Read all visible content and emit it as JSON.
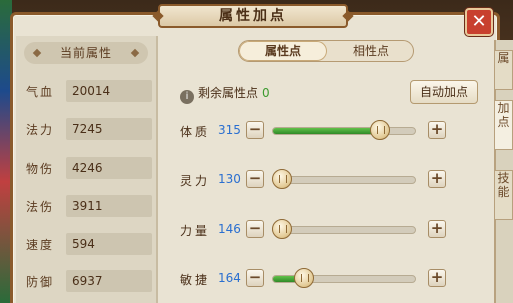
{
  "window": {
    "title": "属性加点",
    "close_label": "✕"
  },
  "left_panel": {
    "header": "当前属性",
    "stats": [
      {
        "label": "气血",
        "value": "20014"
      },
      {
        "label": "法力",
        "value": "7245"
      },
      {
        "label": "物伤",
        "value": "4246"
      },
      {
        "label": "法伤",
        "value": "3911"
      },
      {
        "label": "速度",
        "value": "594"
      },
      {
        "label": "防御",
        "value": "6937"
      }
    ]
  },
  "tabs": [
    {
      "label": "属性点",
      "active": true
    },
    {
      "label": "相性点",
      "active": false
    }
  ],
  "remaining": {
    "label": "剩余属性点",
    "value": "0"
  },
  "auto_button": "自动加点",
  "attributes": [
    {
      "label": "体质",
      "value": "315",
      "fill": 0.75
    },
    {
      "label": "灵力",
      "value": "130",
      "fill": 0.0
    },
    {
      "label": "力量",
      "value": "146",
      "fill": 0.0
    },
    {
      "label": "敏捷",
      "value": "164",
      "fill": 0.22
    }
  ],
  "side_tabs": [
    "属",
    "加点",
    "技能"
  ],
  "icons": {
    "info": "i",
    "minus": "−",
    "plus": "+"
  },
  "colors": {
    "frame": "#8a5a2b",
    "value_blue": "#2a6fd0",
    "remain_green": "#3c9a2e",
    "slider_green": "#3f9a30",
    "close_red": "#c8402e"
  }
}
